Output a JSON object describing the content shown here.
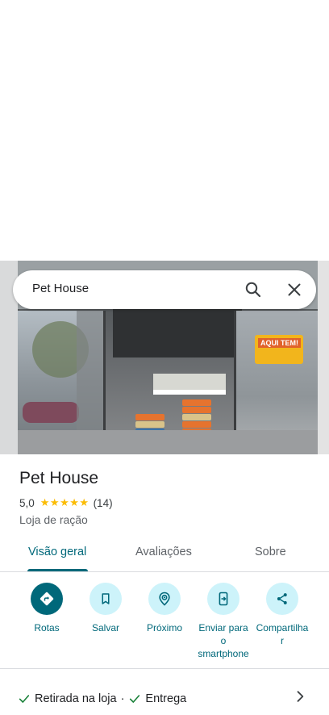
{
  "search": {
    "query": "Pet House"
  },
  "photo": {
    "sign_text": "AQUI TEM!"
  },
  "place": {
    "name": "Pet House",
    "rating": "5,0",
    "stars": "★★★★★",
    "review_count": "(14)",
    "category": "Loja de ração"
  },
  "tabs": [
    {
      "label": "Visão geral",
      "active": true
    },
    {
      "label": "Avaliações",
      "active": false
    },
    {
      "label": "Sobre",
      "active": false
    }
  ],
  "actions": [
    {
      "label": "Rotas",
      "icon": "directions-icon"
    },
    {
      "label": "Salvar",
      "icon": "bookmark-icon"
    },
    {
      "label": "Próximo",
      "icon": "nearby-icon"
    },
    {
      "label_lines": [
        "Enviar para",
        "o",
        "smartphone"
      ],
      "icon": "send-to-phone-icon"
    },
    {
      "label_lines": [
        "Compartilha",
        "r"
      ],
      "icon": "share-icon"
    }
  ],
  "services": {
    "item1": "Retirada na loja",
    "separator": "·",
    "item2": "Entrega"
  },
  "colors": {
    "accent": "#00687a",
    "action_bg": "#cdf3fa",
    "star": "#fbbc04",
    "check": "#188038"
  }
}
